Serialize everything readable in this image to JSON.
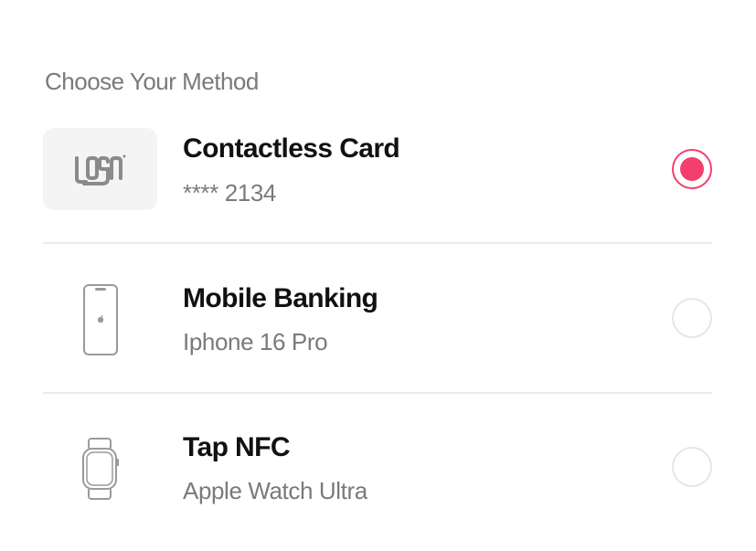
{
  "heading": "Choose Your Method",
  "methods": [
    {
      "title": "Contactless Card",
      "subtitle": "**** 2134",
      "icon": "card-logo-icon",
      "selected": true
    },
    {
      "title": "Mobile Banking",
      "subtitle": "Iphone 16 Pro",
      "icon": "smartphone-icon",
      "selected": false
    },
    {
      "title": "Tap NFC",
      "subtitle": "Apple Watch Ultra",
      "icon": "smartwatch-icon",
      "selected": false
    }
  ],
  "card_logo_text": "LOGO",
  "colors": {
    "accent": "#f43f6e",
    "title": "#111111",
    "muted": "#7a7a7a",
    "divider": "#ececec",
    "card_bg": "#f4f4f4",
    "radio_border": "#e6e6e6"
  }
}
